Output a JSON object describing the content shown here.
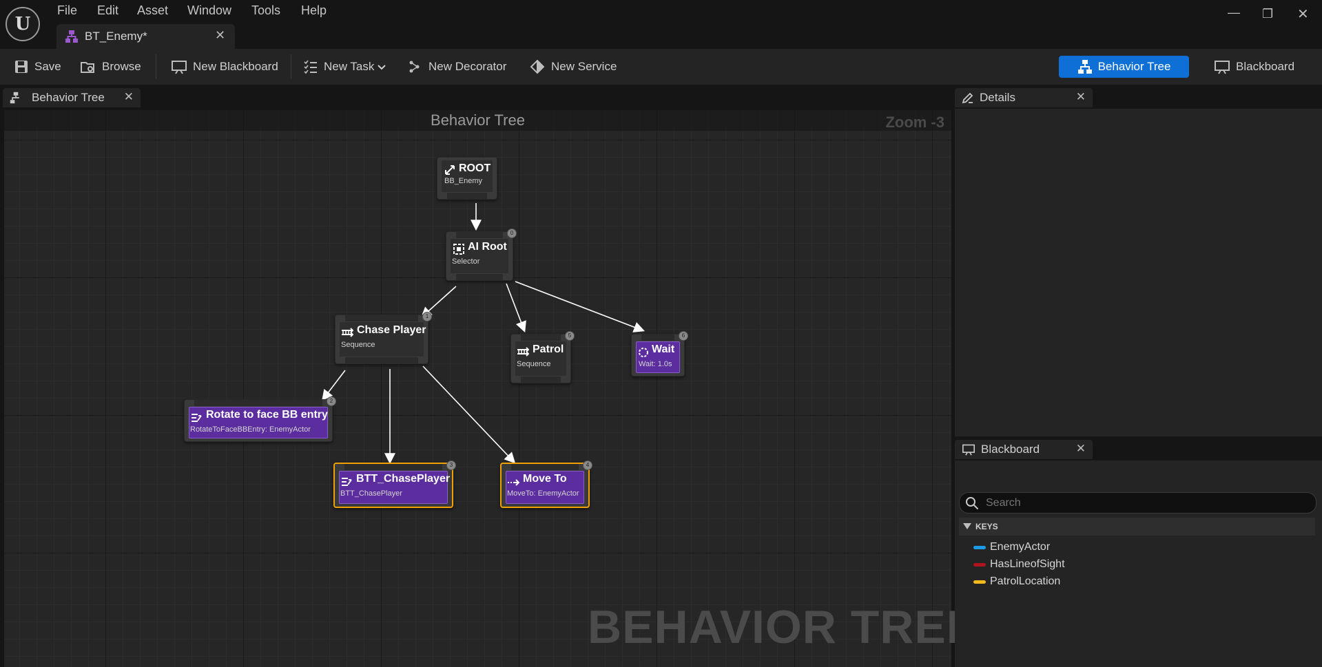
{
  "menu": [
    "File",
    "Edit",
    "Asset",
    "Window",
    "Tools",
    "Help"
  ],
  "document_tab": {
    "label": "BT_Enemy*"
  },
  "toolbar": {
    "save": "Save",
    "browse": "Browse",
    "new_blackboard": "New Blackboard",
    "new_task": "New Task",
    "new_decorator": "New Decorator",
    "new_service": "New Service",
    "mode_behavior_tree": "Behavior Tree",
    "mode_blackboard": "Blackboard"
  },
  "graph_tab": {
    "label": "Behavior Tree"
  },
  "graph": {
    "title": "Behavior Tree",
    "zoom": "Zoom -3",
    "watermark": "BEHAVIOR TREE",
    "nodes": {
      "root": {
        "title": "ROOT",
        "subtitle": "BB_Enemy"
      },
      "ai_root": {
        "title": "AI Root",
        "subtitle": "Selector",
        "index": "0"
      },
      "chase_player": {
        "title": "Chase Player",
        "subtitle": "Sequence",
        "index": "1"
      },
      "patrol": {
        "title": "Patrol",
        "subtitle": "Sequence",
        "index": "5"
      },
      "wait": {
        "title": "Wait",
        "subtitle": "Wait: 1.0s",
        "index": "6"
      },
      "rotate": {
        "title": "Rotate to face BB entry",
        "subtitle": "RotateToFaceBBEntry: EnemyActor",
        "index": "2"
      },
      "btt_chase": {
        "title": "BTT_ChasePlayer",
        "subtitle": "BTT_ChasePlayer",
        "index": "3"
      },
      "move_to": {
        "title": "Move To",
        "subtitle": "MoveTo: EnemyActor",
        "index": "4"
      }
    }
  },
  "details_panel": {
    "label": "Details"
  },
  "blackboard_panel": {
    "label": "Blackboard",
    "search_placeholder": "Search",
    "keys_header": "KEYS",
    "keys": [
      {
        "name": "EnemyActor",
        "color": "#1e9be8"
      },
      {
        "name": "HasLineofSight",
        "color": "#b0141e"
      },
      {
        "name": "PatrolLocation",
        "color": "#f2b81c"
      }
    ]
  },
  "colors": {
    "accent": "#0e6fd6",
    "task_node": "#5b2d9e",
    "selection": "#f0a000"
  }
}
